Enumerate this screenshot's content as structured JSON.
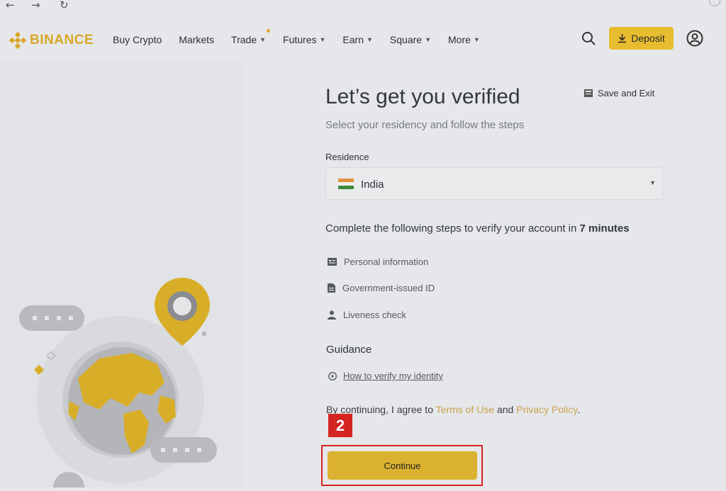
{
  "browser": {
    "back": "←",
    "forward": "→",
    "reload": "↻"
  },
  "header": {
    "logo_text": "BINANCE",
    "nav": [
      {
        "label": "Buy Crypto",
        "has_menu": false
      },
      {
        "label": "Markets",
        "has_menu": false
      },
      {
        "label": "Trade",
        "has_menu": true,
        "has_dot": true
      },
      {
        "label": "Futures",
        "has_menu": true
      },
      {
        "label": "Earn",
        "has_menu": true
      },
      {
        "label": "Square",
        "has_menu": true
      },
      {
        "label": "More",
        "has_menu": true
      }
    ],
    "deposit_label": "Deposit",
    "icons": {
      "search": "search-icon",
      "download": "download-icon",
      "user": "user-icon"
    }
  },
  "verify": {
    "title": "Let’s get you verified",
    "save_exit": "Save and Exit",
    "subtitle": "Select your residency and follow the steps",
    "residence_label": "Residence",
    "residence_value": "India",
    "steps_intro": "Complete the following steps to verify your account in ",
    "steps_time": "7 minutes",
    "steps": [
      {
        "label": "Personal information",
        "icon": "id-card-icon"
      },
      {
        "label": "Government-issued ID",
        "icon": "document-icon"
      },
      {
        "label": "Liveness check",
        "icon": "person-icon"
      }
    ],
    "guidance_heading": "Guidance",
    "guidance_link": "How to verify my identity",
    "terms_prefix": "By continuing, I agree to ",
    "terms_link": "Terms of Use",
    "terms_and": " and ",
    "privacy_link": "Privacy Policy",
    "terms_suffix": ".",
    "continue_label": "Continue"
  },
  "annotation": {
    "step_number": "2"
  },
  "colors": {
    "brand": "#d7a828",
    "accent_button": "#dbb22f",
    "annotation": "#d42420",
    "link": "#c9a24c"
  }
}
